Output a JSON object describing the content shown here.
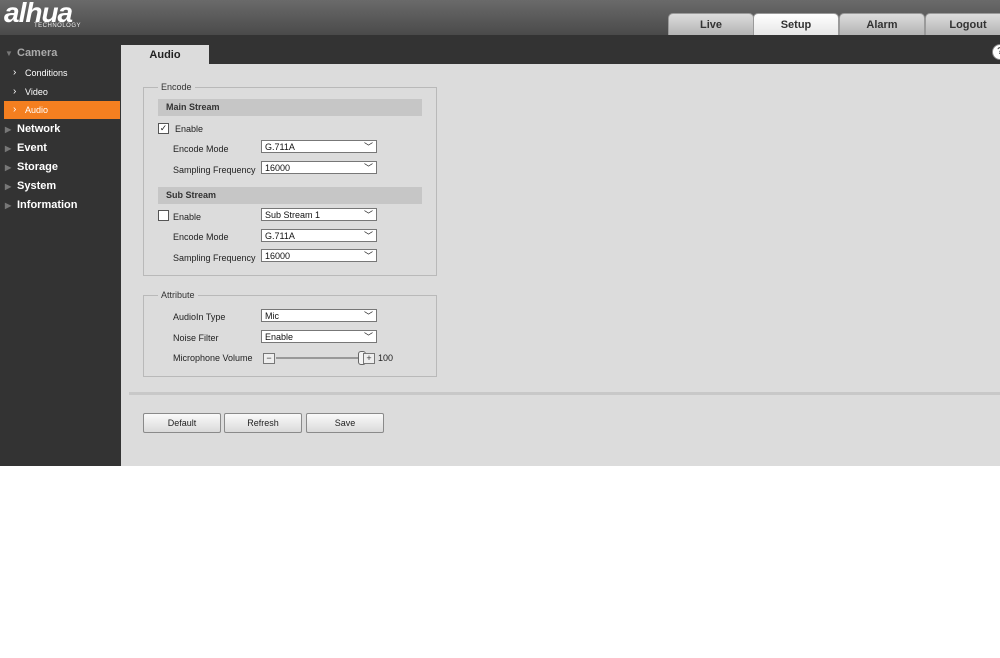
{
  "header": {
    "logo": "alhua",
    "logo_sub": "TECHNOLOGY",
    "tabs": [
      {
        "label": "Live"
      },
      {
        "label": "Setup"
      },
      {
        "label": "Alarm"
      },
      {
        "label": "Logout"
      }
    ],
    "active_tab": "Setup"
  },
  "sidebar": {
    "camera": {
      "label": "Camera",
      "items": [
        {
          "label": "Conditions"
        },
        {
          "label": "Video"
        },
        {
          "label": "Audio"
        }
      ],
      "active_item": "Audio"
    },
    "groups": [
      {
        "label": "Network"
      },
      {
        "label": "Event"
      },
      {
        "label": "Storage"
      },
      {
        "label": "System"
      },
      {
        "label": "Information"
      }
    ]
  },
  "page": {
    "tab_label": "Audio",
    "help_label": "?"
  },
  "encode": {
    "legend": "Encode",
    "main_stream": {
      "heading": "Main Stream",
      "enable_label": "Enable",
      "enable_checked": true,
      "encode_mode_label": "Encode Mode",
      "encode_mode_value": "G.711A",
      "sampling_label": "Sampling Frequency",
      "sampling_value": "16000"
    },
    "sub_stream": {
      "heading": "Sub Stream",
      "enable_label": "Enable",
      "enable_checked": false,
      "stream_value": "Sub Stream 1",
      "encode_mode_label": "Encode Mode",
      "encode_mode_value": "G.711A",
      "sampling_label": "Sampling Frequency",
      "sampling_value": "16000"
    }
  },
  "attribute": {
    "legend": "Attribute",
    "audioin_type_label": "AudioIn Type",
    "audioin_type_value": "Mic",
    "noise_filter_label": "Noise Filter",
    "noise_filter_value": "Enable",
    "mic_volume_label": "Microphone Volume",
    "mic_volume_value": "100",
    "mic_volume_level": 1.0
  },
  "buttons": {
    "default_label": "Default",
    "refresh_label": "Refresh",
    "save_label": "Save"
  },
  "colors": {
    "accent": "#f47f20",
    "sidebar_bg": "#333333",
    "content_bg": "#dcdcdc"
  }
}
